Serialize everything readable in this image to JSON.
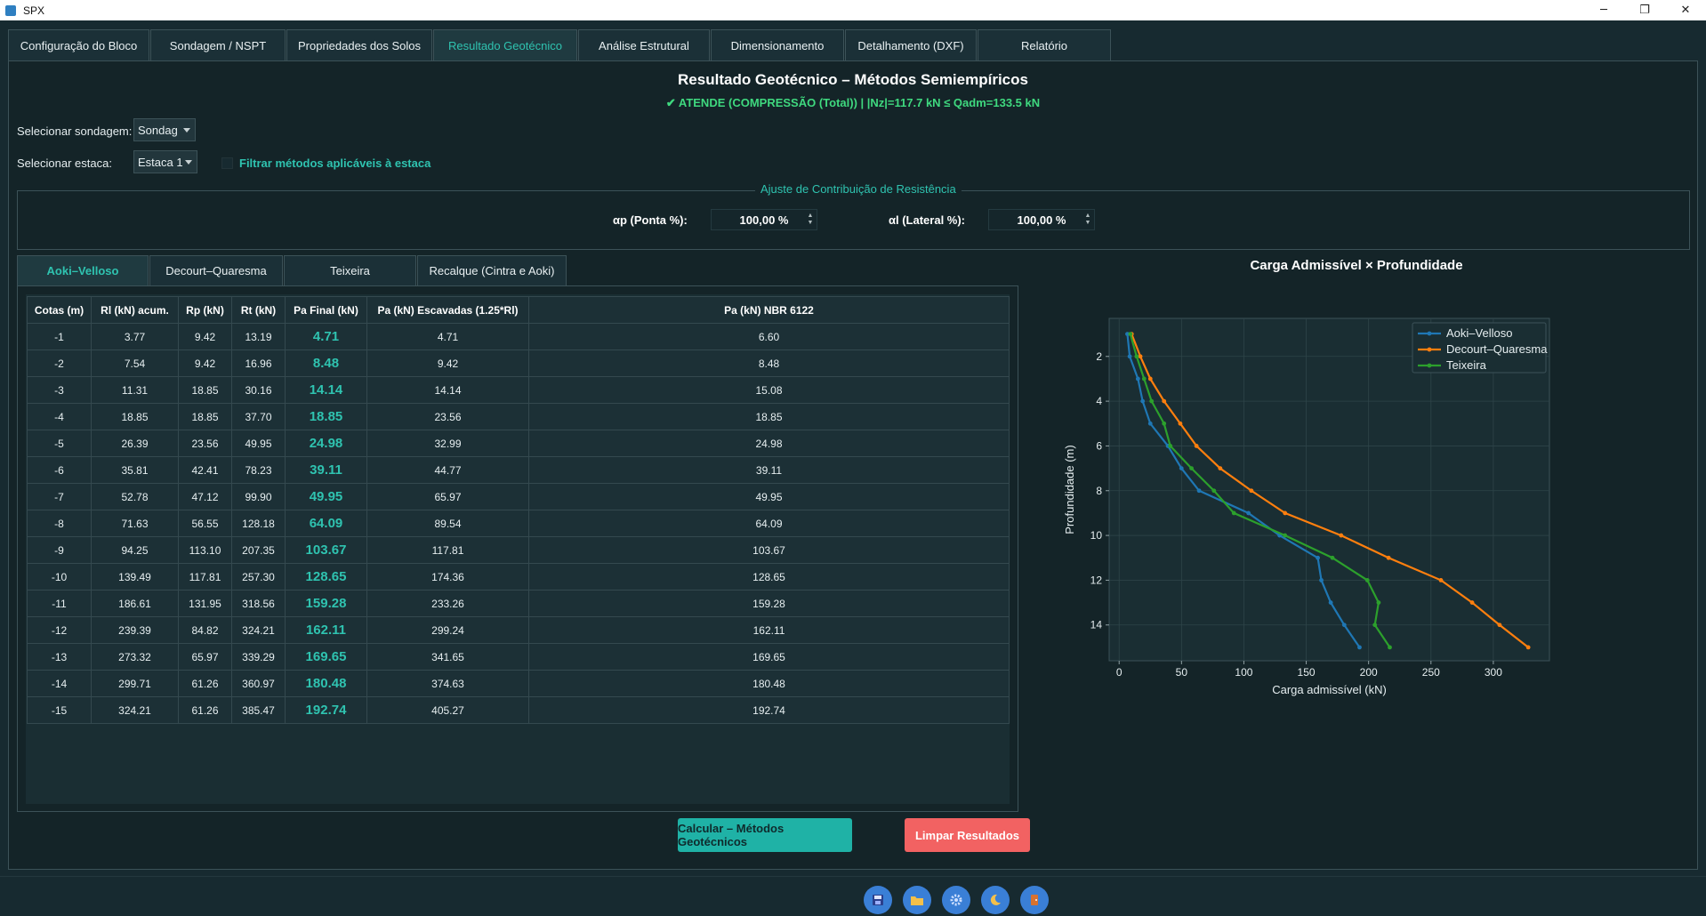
{
  "window": {
    "title": "SPX",
    "minimize": "─",
    "maximize": "❐",
    "close": "✕"
  },
  "tabs": [
    {
      "label": "Configuração do Bloco"
    },
    {
      "label": "Sondagem / NSPT"
    },
    {
      "label": "Propriedades dos Solos"
    },
    {
      "label": "Resultado Geotécnico"
    },
    {
      "label": "Análise Estrutural"
    },
    {
      "label": "Dimensionamento"
    },
    {
      "label": "Detalhamento (DXF)"
    },
    {
      "label": "Relatório"
    }
  ],
  "header": {
    "title": "Resultado Geotécnico – Métodos Semiempíricos",
    "status": "✔ ATENDE (COMPRESSÃO (Total)) | |Nz|=117.7 kN ≤ Qadm=133.5 kN"
  },
  "controls": {
    "sondagem_label": "Selecionar sondagem:",
    "sondagem_value": "Sondag",
    "estaca_label": "Selecionar estaca:",
    "estaca_value": "Estaca 1",
    "filter_label": "Filtrar métodos aplicáveis à estaca"
  },
  "ajuste": {
    "title": "Ajuste de Contribuição de Resistência",
    "ap_label": "αp (Ponta %):",
    "ap_value": "100,00 %",
    "al_label": "αl (Lateral %):",
    "al_value": "100,00 %"
  },
  "subtabs": [
    {
      "label": "Aoki–Velloso"
    },
    {
      "label": "Decourt–Quaresma"
    },
    {
      "label": "Teixeira"
    },
    {
      "label": "Recalque (Cintra e Aoki)"
    }
  ],
  "table": {
    "headers": [
      "Cotas (m)",
      "Rl (kN) acum.",
      "Rp (kN)",
      "Rt (kN)",
      "Pa Final (kN)",
      "Pa (kN) Escavadas (1.25*Rl)",
      "Pa (kN) NBR 6122"
    ],
    "rows": [
      [
        "-1",
        "3.77",
        "9.42",
        "13.19",
        "4.71",
        "4.71",
        "6.60"
      ],
      [
        "-2",
        "7.54",
        "9.42",
        "16.96",
        "8.48",
        "9.42",
        "8.48"
      ],
      [
        "-3",
        "11.31",
        "18.85",
        "30.16",
        "14.14",
        "14.14",
        "15.08"
      ],
      [
        "-4",
        "18.85",
        "18.85",
        "37.70",
        "18.85",
        "23.56",
        "18.85"
      ],
      [
        "-5",
        "26.39",
        "23.56",
        "49.95",
        "24.98",
        "32.99",
        "24.98"
      ],
      [
        "-6",
        "35.81",
        "42.41",
        "78.23",
        "39.11",
        "44.77",
        "39.11"
      ],
      [
        "-7",
        "52.78",
        "47.12",
        "99.90",
        "49.95",
        "65.97",
        "49.95"
      ],
      [
        "-8",
        "71.63",
        "56.55",
        "128.18",
        "64.09",
        "89.54",
        "64.09"
      ],
      [
        "-9",
        "94.25",
        "113.10",
        "207.35",
        "103.67",
        "117.81",
        "103.67"
      ],
      [
        "-10",
        "139.49",
        "117.81",
        "257.30",
        "128.65",
        "174.36",
        "128.65"
      ],
      [
        "-11",
        "186.61",
        "131.95",
        "318.56",
        "159.28",
        "233.26",
        "159.28"
      ],
      [
        "-12",
        "239.39",
        "84.82",
        "324.21",
        "162.11",
        "299.24",
        "162.11"
      ],
      [
        "-13",
        "273.32",
        "65.97",
        "339.29",
        "169.65",
        "341.65",
        "169.65"
      ],
      [
        "-14",
        "299.71",
        "61.26",
        "360.97",
        "180.48",
        "374.63",
        "180.48"
      ],
      [
        "-15",
        "324.21",
        "61.26",
        "385.47",
        "192.74",
        "405.27",
        "192.74"
      ]
    ]
  },
  "chart_data": {
    "type": "line",
    "title": "Carga Admissível × Profundidade",
    "xlabel": "Carga admissível (kN)",
    "ylabel": "Profundidade (m)",
    "xlim": [
      -8,
      345
    ],
    "ylim": [
      15.6,
      0.3
    ],
    "xticks": [
      0,
      50,
      100,
      150,
      200,
      250,
      300
    ],
    "yticks": [
      2,
      4,
      6,
      8,
      10,
      12,
      14
    ],
    "grid": true,
    "legend_position": "top-right",
    "y": [
      1,
      2,
      3,
      4,
      5,
      6,
      7,
      8,
      9,
      10,
      11,
      12,
      13,
      14,
      15
    ],
    "series": [
      {
        "name": "Aoki–Velloso",
        "color": "#1f77b4",
        "values": [
          6.6,
          8.48,
          15.08,
          18.85,
          24.98,
          39.11,
          49.95,
          64.09,
          103.67,
          128.65,
          159.28,
          162.11,
          169.65,
          180.48,
          192.74
        ]
      },
      {
        "name": "Decourt–Quaresma",
        "color": "#ff7f0e",
        "values": [
          10,
          17,
          25,
          36,
          49,
          62,
          81,
          106,
          133,
          178,
          216,
          258,
          283,
          305,
          328
        ]
      },
      {
        "name": "Teixeira",
        "color": "#2ca02c",
        "values": [
          9,
          14,
          20,
          26,
          36,
          41,
          58,
          76,
          92,
          133,
          171,
          199,
          208,
          205,
          217
        ]
      }
    ]
  },
  "buttons": {
    "calc": "Calcular – Métodos Geotécnicos",
    "clear": "Limpar Resultados"
  },
  "bottom_icons": [
    "save-icon",
    "folder-icon",
    "gear-icon",
    "moon-icon",
    "exit-icon"
  ]
}
